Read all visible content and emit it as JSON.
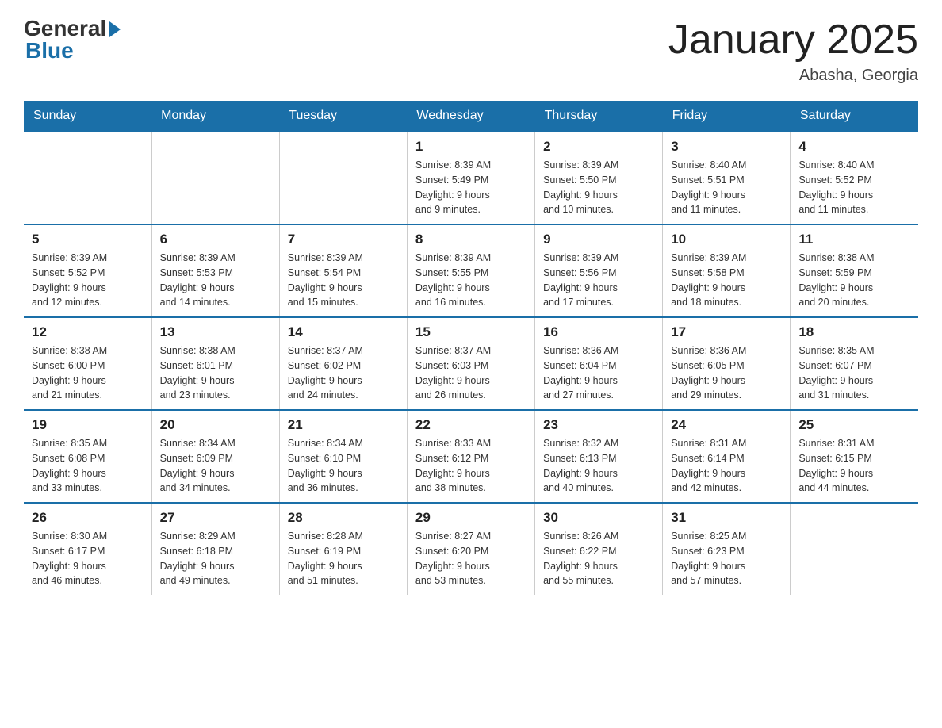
{
  "logo": {
    "general": "General",
    "blue": "Blue"
  },
  "title": "January 2025",
  "location": "Abasha, Georgia",
  "days_of_week": [
    "Sunday",
    "Monday",
    "Tuesday",
    "Wednesday",
    "Thursday",
    "Friday",
    "Saturday"
  ],
  "weeks": [
    [
      {
        "day": "",
        "info": ""
      },
      {
        "day": "",
        "info": ""
      },
      {
        "day": "",
        "info": ""
      },
      {
        "day": "1",
        "info": "Sunrise: 8:39 AM\nSunset: 5:49 PM\nDaylight: 9 hours\nand 9 minutes."
      },
      {
        "day": "2",
        "info": "Sunrise: 8:39 AM\nSunset: 5:50 PM\nDaylight: 9 hours\nand 10 minutes."
      },
      {
        "day": "3",
        "info": "Sunrise: 8:40 AM\nSunset: 5:51 PM\nDaylight: 9 hours\nand 11 minutes."
      },
      {
        "day": "4",
        "info": "Sunrise: 8:40 AM\nSunset: 5:52 PM\nDaylight: 9 hours\nand 11 minutes."
      }
    ],
    [
      {
        "day": "5",
        "info": "Sunrise: 8:39 AM\nSunset: 5:52 PM\nDaylight: 9 hours\nand 12 minutes."
      },
      {
        "day": "6",
        "info": "Sunrise: 8:39 AM\nSunset: 5:53 PM\nDaylight: 9 hours\nand 14 minutes."
      },
      {
        "day": "7",
        "info": "Sunrise: 8:39 AM\nSunset: 5:54 PM\nDaylight: 9 hours\nand 15 minutes."
      },
      {
        "day": "8",
        "info": "Sunrise: 8:39 AM\nSunset: 5:55 PM\nDaylight: 9 hours\nand 16 minutes."
      },
      {
        "day": "9",
        "info": "Sunrise: 8:39 AM\nSunset: 5:56 PM\nDaylight: 9 hours\nand 17 minutes."
      },
      {
        "day": "10",
        "info": "Sunrise: 8:39 AM\nSunset: 5:58 PM\nDaylight: 9 hours\nand 18 minutes."
      },
      {
        "day": "11",
        "info": "Sunrise: 8:38 AM\nSunset: 5:59 PM\nDaylight: 9 hours\nand 20 minutes."
      }
    ],
    [
      {
        "day": "12",
        "info": "Sunrise: 8:38 AM\nSunset: 6:00 PM\nDaylight: 9 hours\nand 21 minutes."
      },
      {
        "day": "13",
        "info": "Sunrise: 8:38 AM\nSunset: 6:01 PM\nDaylight: 9 hours\nand 23 minutes."
      },
      {
        "day": "14",
        "info": "Sunrise: 8:37 AM\nSunset: 6:02 PM\nDaylight: 9 hours\nand 24 minutes."
      },
      {
        "day": "15",
        "info": "Sunrise: 8:37 AM\nSunset: 6:03 PM\nDaylight: 9 hours\nand 26 minutes."
      },
      {
        "day": "16",
        "info": "Sunrise: 8:36 AM\nSunset: 6:04 PM\nDaylight: 9 hours\nand 27 minutes."
      },
      {
        "day": "17",
        "info": "Sunrise: 8:36 AM\nSunset: 6:05 PM\nDaylight: 9 hours\nand 29 minutes."
      },
      {
        "day": "18",
        "info": "Sunrise: 8:35 AM\nSunset: 6:07 PM\nDaylight: 9 hours\nand 31 minutes."
      }
    ],
    [
      {
        "day": "19",
        "info": "Sunrise: 8:35 AM\nSunset: 6:08 PM\nDaylight: 9 hours\nand 33 minutes."
      },
      {
        "day": "20",
        "info": "Sunrise: 8:34 AM\nSunset: 6:09 PM\nDaylight: 9 hours\nand 34 minutes."
      },
      {
        "day": "21",
        "info": "Sunrise: 8:34 AM\nSunset: 6:10 PM\nDaylight: 9 hours\nand 36 minutes."
      },
      {
        "day": "22",
        "info": "Sunrise: 8:33 AM\nSunset: 6:12 PM\nDaylight: 9 hours\nand 38 minutes."
      },
      {
        "day": "23",
        "info": "Sunrise: 8:32 AM\nSunset: 6:13 PM\nDaylight: 9 hours\nand 40 minutes."
      },
      {
        "day": "24",
        "info": "Sunrise: 8:31 AM\nSunset: 6:14 PM\nDaylight: 9 hours\nand 42 minutes."
      },
      {
        "day": "25",
        "info": "Sunrise: 8:31 AM\nSunset: 6:15 PM\nDaylight: 9 hours\nand 44 minutes."
      }
    ],
    [
      {
        "day": "26",
        "info": "Sunrise: 8:30 AM\nSunset: 6:17 PM\nDaylight: 9 hours\nand 46 minutes."
      },
      {
        "day": "27",
        "info": "Sunrise: 8:29 AM\nSunset: 6:18 PM\nDaylight: 9 hours\nand 49 minutes."
      },
      {
        "day": "28",
        "info": "Sunrise: 8:28 AM\nSunset: 6:19 PM\nDaylight: 9 hours\nand 51 minutes."
      },
      {
        "day": "29",
        "info": "Sunrise: 8:27 AM\nSunset: 6:20 PM\nDaylight: 9 hours\nand 53 minutes."
      },
      {
        "day": "30",
        "info": "Sunrise: 8:26 AM\nSunset: 6:22 PM\nDaylight: 9 hours\nand 55 minutes."
      },
      {
        "day": "31",
        "info": "Sunrise: 8:25 AM\nSunset: 6:23 PM\nDaylight: 9 hours\nand 57 minutes."
      },
      {
        "day": "",
        "info": ""
      }
    ]
  ]
}
